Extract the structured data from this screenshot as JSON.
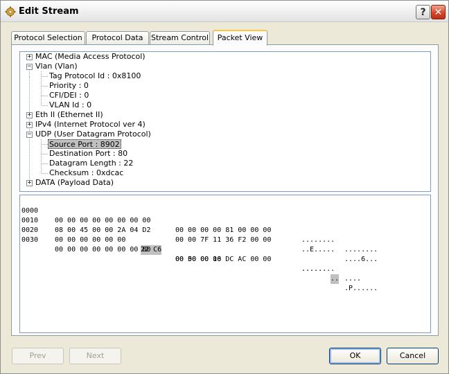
{
  "window": {
    "title": "Edit Stream"
  },
  "tabs": [
    {
      "label": "Protocol Selection"
    },
    {
      "label": "Protocol Data"
    },
    {
      "label": "Stream Control"
    },
    {
      "label": "Packet View",
      "active": true
    }
  ],
  "tree": {
    "nodes": [
      {
        "label": "MAC (Media Access Protocol)",
        "expander": "+"
      },
      {
        "label": "Vlan (Vlan)",
        "expander": "−"
      },
      {
        "label": "Tag Protocol Id : 0x8100"
      },
      {
        "label": "Priority : 0"
      },
      {
        "label": "CFI/DEI : 0"
      },
      {
        "label": "VLAN Id : 0"
      },
      {
        "label": "Eth II (Ethernet II)",
        "expander": "+"
      },
      {
        "label": "IPv4 (Internet Protocol ver 4)",
        "expander": "+"
      },
      {
        "label": "UDP (User Datagram Protocol)",
        "expander": "−"
      },
      {
        "label": "Source Port : 8902",
        "selected": true
      },
      {
        "label": "Destination Port : 80"
      },
      {
        "label": "Datagram Length : 22"
      },
      {
        "label": "Checksum : 0xdcac"
      },
      {
        "label": "DATA (Payload Data)",
        "expander": "+"
      }
    ]
  },
  "hex": {
    "rows": [
      {
        "offset": "0000",
        "bytes_a": "00 00 00 00 00 00 00 00",
        "bytes_b": "00 00 00 00 81 00 00 00",
        "ascii_a": "........",
        "ascii_b": "........"
      },
      {
        "offset": "0010",
        "bytes_a": "08 00 45 00 00 2A 04 D2",
        "bytes_b": "00 00 7F 11 36 F2 00 00",
        "ascii_a": "..E.....",
        "ascii_b": "....6..."
      },
      {
        "offset": "0020",
        "bytes_pre": "00 00 00 00 00 00 ",
        "bytes_hl": "22 C6",
        "bytes_b": "00 50 00 16 DC AC 00 00",
        "ascii_pre": "......",
        "ascii_hl": "..",
        "ascii_b": ".P......"
      },
      {
        "offset": "0030",
        "bytes_a": "00 00 00 00 00 00 00 00",
        "bytes_b": "00 00 00 00",
        "ascii_a": "........",
        "ascii_b": "...."
      }
    ]
  },
  "buttons": {
    "prev": "Prev",
    "next": "Next",
    "ok": "OK",
    "cancel": "Cancel"
  },
  "colors": {
    "title_close": "#d8462a",
    "tab_highlight": "#ffc83c",
    "selection": "#c0c0c0"
  }
}
